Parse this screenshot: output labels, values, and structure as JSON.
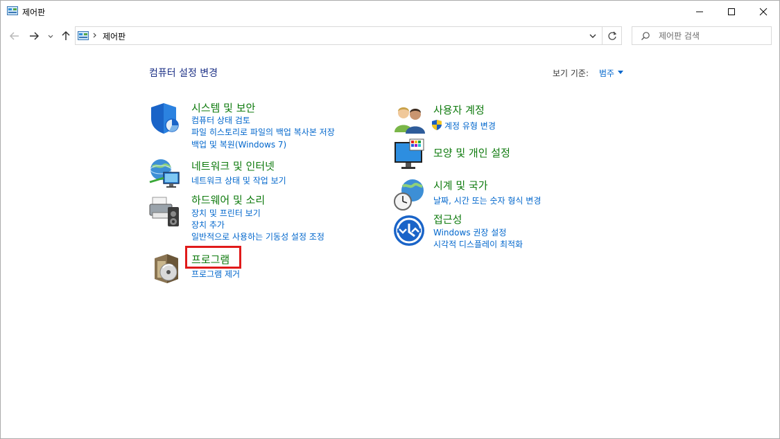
{
  "window": {
    "title": "제어판"
  },
  "nav": {
    "breadcrumb": "제어판",
    "search_placeholder": "제어판 검색"
  },
  "content": {
    "heading": "컴퓨터 설정 변경",
    "view_by_label": "보기 기준:",
    "view_by_value": "범주"
  },
  "categories": [
    {
      "title": "시스템 및 보안",
      "icon": "shield-icon",
      "links": [
        "컴퓨터 상태 검토",
        "파일 히스토리로 파일의 백업 복사본 저장",
        "백업 및 복원(Windows 7)"
      ]
    },
    {
      "title": "네트워크 및 인터넷",
      "icon": "network-globe-icon",
      "links": [
        "네트워크 상태 및 작업 보기"
      ]
    },
    {
      "title": "하드웨어 및 소리",
      "icon": "printer-speaker-icon",
      "links": [
        "장치 및 프린터 보기",
        "장치 추가",
        "일반적으로 사용하는 기동성 설정 조정"
      ]
    },
    {
      "title": "프로그램",
      "icon": "programs-disc-icon",
      "links": [
        "프로그램 제거"
      ]
    },
    {
      "title": "사용자 계정",
      "icon": "users-icon",
      "links": [
        "계정 유형 변경"
      ]
    },
    {
      "title": "모양 및 개인 설정",
      "icon": "monitor-palette-icon",
      "links": []
    },
    {
      "title": "시계 및 국가",
      "icon": "clock-globe-icon",
      "links": [
        "날짜, 시간 또는 숫자 형식 변경"
      ]
    },
    {
      "title": "접근성",
      "icon": "ease-of-access-icon",
      "links": [
        "Windows 권장 설정",
        "시각적 디스플레이 최적화"
      ]
    }
  ],
  "colors": {
    "category_title": "#0e7a0d",
    "link": "#0066cc",
    "heading": "#1e3287",
    "highlight": "#e01a1a"
  }
}
